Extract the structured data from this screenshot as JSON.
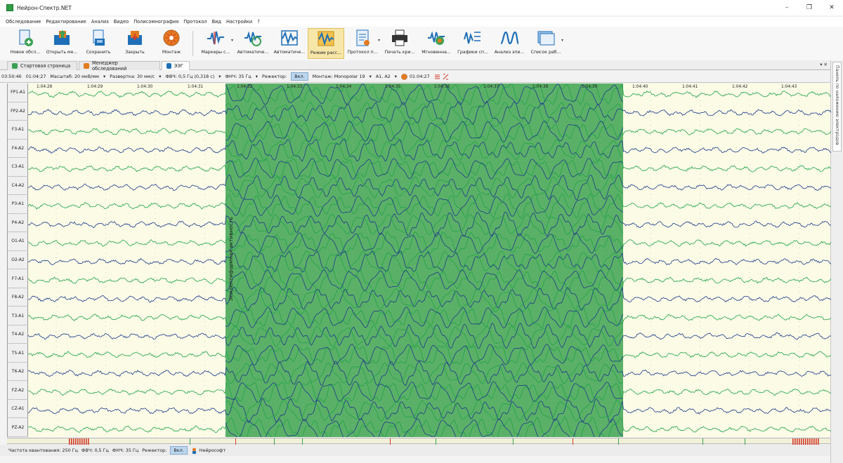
{
  "app": {
    "title": "Нейрон-Спектр.NET"
  },
  "window_controls": {
    "minimize": "–",
    "maximize": "❐",
    "close": "✕"
  },
  "menu": [
    "Обследование",
    "Редактирование",
    "Анализ",
    "Видео",
    "Полисомнография",
    "Протокол",
    "Вид",
    "Настройки",
    "?"
  ],
  "toolbar": {
    "buttons": [
      {
        "label": "Новое обсл...",
        "icon": "new-exam-icon"
      },
      {
        "label": "Открыть ме...",
        "icon": "open-folder-icon"
      },
      {
        "label": "Сохранить",
        "icon": "save-icon"
      },
      {
        "label": "Закрыть",
        "icon": "close-doc-icon"
      },
      {
        "label": "Монтаж",
        "icon": "montage-icon"
      },
      {
        "label": "Маркеры с...",
        "icon": "markers-icon"
      },
      {
        "label": "Автоматиче...",
        "icon": "auto-analysis-icon"
      },
      {
        "label": "Автоматиче...",
        "icon": "auto-detect-icon"
      },
      {
        "label": "Режим расс...",
        "icon": "view-mode-icon"
      },
      {
        "label": "Протокол п...",
        "icon": "protocol-icon"
      },
      {
        "label": "Печать кри...",
        "icon": "print-icon"
      },
      {
        "label": "Мгновенна...",
        "icon": "instant-map-icon"
      },
      {
        "label": "Графики сп...",
        "icon": "spectrum-graph-icon"
      },
      {
        "label": "Анализ эпи...",
        "icon": "epi-analysis-icon"
      },
      {
        "label": "Список раб...",
        "icon": "work-list-icon"
      }
    ],
    "active_index": 8,
    "colors": {
      "accent_blue": "#1f6fb8",
      "accent_green": "#3aa154",
      "accent_orange": "#e37b1e",
      "accent_red": "#d43b2a"
    }
  },
  "tabs": [
    {
      "label": "Стартовая страница",
      "icon": "start-page-icon"
    },
    {
      "label": "Менеджер обследований",
      "icon": "exam-manager-icon"
    },
    {
      "label": "ЭЭГ",
      "icon": "eeg-icon"
    }
  ],
  "tabs_pin": "▾ ✕",
  "side_panel": {
    "label": "Панель по наложению электродов"
  },
  "controls": {
    "total_time": "03:50:46",
    "current_time": "01:04:27",
    "scale": "Масштаб: 20 мкВ/мм",
    "sweep": "Развертка: 30 мм/с",
    "hpf": "ФВЧ: 0,5 Гц (0,318 с)",
    "lpf": "ФНЧ: 35 Гц",
    "notch_label": "Режектор:",
    "notch_value": "Вкл.",
    "montage": "Монтаж: Monopolar 19",
    "reference": "A1, A2",
    "marker_time": "01:04:27"
  },
  "eeg": {
    "channels": [
      "FP1-A1",
      "FP2-A2",
      "F3-A1",
      "F4-A2",
      "C3-A1",
      "C4-A2",
      "P3-A1",
      "P4-A2",
      "O1-A1",
      "O2-A2",
      "F7-A1",
      "F8-A2",
      "T3-A1",
      "T4-A2",
      "T5-A1",
      "T6-A2",
      "FZ-A2",
      "CZ-A1",
      "PZ-A2"
    ],
    "time_ticks": [
      "1:04:28",
      "1:04:29",
      "1:04:30",
      "1:04:31",
      "1:04:32",
      "1:04:33",
      "1:04:34",
      "1:04:35",
      "1:04:36",
      "1:04:37",
      "1:04:38",
      "1:04:39",
      "1:04:40",
      "1:04:41",
      "1:04:42",
      "1:04:43"
    ],
    "event_label": "Эпилептиформная активность",
    "colors": {
      "background": "#fbfbe6",
      "event": "#5bb067",
      "trace_dark": "#1b3a8a",
      "trace_light": "#1fa348",
      "grid_dots": "#b0b0b0"
    }
  },
  "status": {
    "sampling": "Частота квантования: 250 Гц",
    "hpf": "ФВЧ: 0,5 Гц",
    "lpf": "ФНЧ: 35 Гц",
    "notch_label": "Режектор:",
    "notch_value": "Вкл.",
    "vendor": "Нейрософт"
  }
}
